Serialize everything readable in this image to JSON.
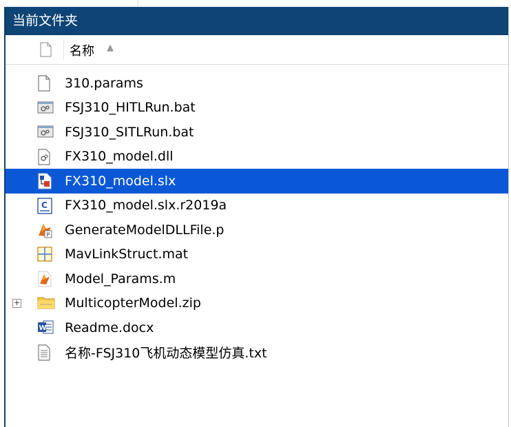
{
  "panel": {
    "title": "当前文件夹",
    "column_header": {
      "name": "名称",
      "sort_indicator": "▲"
    }
  },
  "files": [
    {
      "name": "310.params",
      "icon": "file-blank-icon",
      "selected": false
    },
    {
      "name": "FSJ310_HITLRun.bat",
      "icon": "batch-file-icon",
      "selected": false
    },
    {
      "name": "FSJ310_SITLRun.bat",
      "icon": "batch-file-icon",
      "selected": false
    },
    {
      "name": "FX310_model.dll",
      "icon": "dll-file-icon",
      "selected": false
    },
    {
      "name": "FX310_model.slx",
      "icon": "simulink-model-icon",
      "selected": true
    },
    {
      "name": "FX310_model.slx.r2019a",
      "icon": "code-file-icon",
      "selected": false
    },
    {
      "name": "GenerateModelDLLFile.p",
      "icon": "matlab-p-file-icon",
      "selected": false
    },
    {
      "name": "MavLinkStruct.mat",
      "icon": "mat-file-icon",
      "selected": false
    },
    {
      "name": "Model_Params.m",
      "icon": "matlab-script-icon",
      "selected": false
    },
    {
      "name": "MulticopterModel.zip",
      "icon": "zip-folder-icon",
      "selected": false,
      "expandable": true
    },
    {
      "name": "Readme.docx",
      "icon": "word-doc-icon",
      "selected": false
    },
    {
      "name": "名称-FSJ310飞机动态模型仿真.txt",
      "icon": "text-file-icon",
      "selected": false
    }
  ],
  "colors": {
    "title_bar": "#0f4576",
    "selection": "#0a58d6",
    "panel_border": "#1b3f66"
  }
}
